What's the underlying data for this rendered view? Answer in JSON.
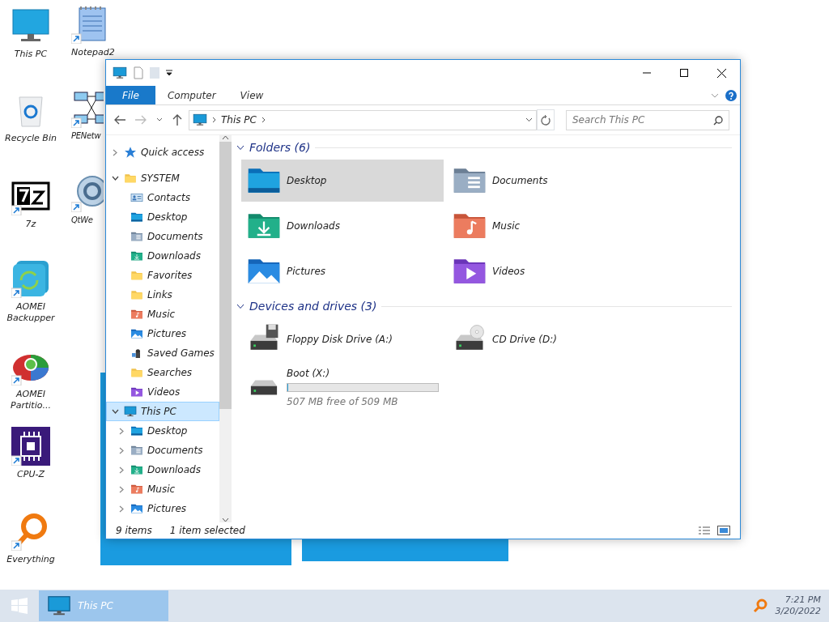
{
  "desktop_icons": [
    {
      "label": "This PC",
      "kind": "pc"
    },
    {
      "label": "Notepad2",
      "kind": "notepad"
    },
    {
      "label": "Recycle Bin",
      "kind": "bin"
    },
    {
      "label": "PENetw",
      "kind": "network"
    },
    {
      "label": "7z",
      "kind": "sevenzip"
    },
    {
      "label": "QtWe",
      "kind": "qt"
    },
    {
      "label": "AOMEI Backupper",
      "kind": "backup"
    },
    {
      "label": "AOMEI Partitio...",
      "kind": "partition"
    },
    {
      "label": "CPU-Z",
      "kind": "cpu"
    },
    {
      "label": "Everything",
      "kind": "search"
    }
  ],
  "window": {
    "ribbon_tabs": [
      {
        "label": "File",
        "selected": true
      },
      {
        "label": "Computer",
        "selected": false
      },
      {
        "label": "View",
        "selected": false
      }
    ],
    "address": {
      "path": "This PC"
    },
    "search": {
      "placeholder": "Search This PC"
    },
    "nav_tree": [
      {
        "label": "Quick access",
        "kind": "star",
        "expanded": false,
        "selected": false
      },
      {
        "label": "SYSTEM",
        "kind": "folder",
        "expanded": true,
        "selected": false,
        "children": [
          {
            "label": "Contacts",
            "kind": "contacts",
            "selected": false
          },
          {
            "label": "Desktop",
            "kind": "desktop",
            "selected": false
          },
          {
            "label": "Documents",
            "kind": "documents",
            "selected": false
          },
          {
            "label": "Downloads",
            "kind": "downloads",
            "selected": false
          },
          {
            "label": "Favorites",
            "kind": "folder",
            "selected": false
          },
          {
            "label": "Links",
            "kind": "folder",
            "selected": false
          },
          {
            "label": "Music",
            "kind": "music",
            "selected": false
          },
          {
            "label": "Pictures",
            "kind": "pictures",
            "selected": false
          },
          {
            "label": "Saved Games",
            "kind": "games",
            "selected": false
          },
          {
            "label": "Searches",
            "kind": "folder",
            "selected": false
          },
          {
            "label": "Videos",
            "kind": "videos",
            "selected": false
          }
        ]
      },
      {
        "label": "This PC",
        "kind": "pc",
        "expanded": true,
        "selected": true,
        "children": [
          {
            "label": "Desktop",
            "kind": "desktop",
            "expanded": false,
            "selected": false
          },
          {
            "label": "Documents",
            "kind": "documents",
            "expanded": false,
            "selected": false
          },
          {
            "label": "Downloads",
            "kind": "downloads",
            "expanded": false,
            "selected": false
          },
          {
            "label": "Music",
            "kind": "music",
            "expanded": false,
            "selected": false
          },
          {
            "label": "Pictures",
            "kind": "pictures",
            "expanded": false,
            "selected": false
          }
        ]
      }
    ],
    "groups": [
      {
        "title": "Folders (6)",
        "items": [
          {
            "label": "Desktop",
            "kind": "desktop",
            "selected": true
          },
          {
            "label": "Documents",
            "kind": "documents",
            "selected": false
          },
          {
            "label": "Downloads",
            "kind": "downloads",
            "selected": false
          },
          {
            "label": "Music",
            "kind": "music",
            "selected": false
          },
          {
            "label": "Pictures",
            "kind": "pictures",
            "selected": false
          },
          {
            "label": "Videos",
            "kind": "videos",
            "selected": false
          }
        ]
      },
      {
        "title": "Devices and drives (3)",
        "items": [
          {
            "label": "Floppy Disk Drive (A:)",
            "kind": "floppy",
            "selected": false
          },
          {
            "label": "CD Drive (D:)",
            "kind": "cd",
            "selected": false
          },
          {
            "label": "Boot (X:)",
            "kind": "drive",
            "selected": false,
            "level": 0.004,
            "detail": "507 MB free of 509 MB"
          }
        ]
      }
    ],
    "status_bar": {
      "count": "9 items",
      "selection": "1 item selected"
    }
  },
  "taskbar": {
    "tasks": [
      {
        "label": "This PC",
        "selected": true
      }
    ],
    "clock": {
      "time": "7:21 PM",
      "date": "3/20/2022"
    }
  }
}
